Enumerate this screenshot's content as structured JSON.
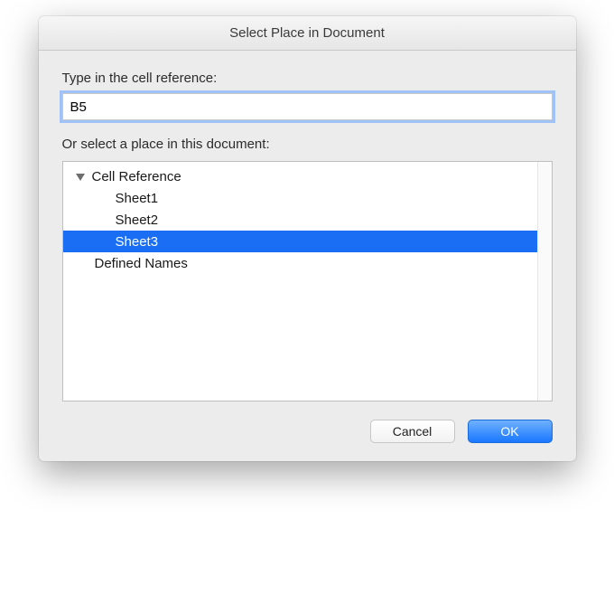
{
  "titlebar": {
    "title": "Select Place in Document"
  },
  "labels": {
    "cell_ref": "Type in the cell reference:",
    "or_select": "Or select a place in this document:"
  },
  "input": {
    "value": "B5"
  },
  "tree": {
    "group1_label": "Cell Reference",
    "group1_expanded": true,
    "group1_items": [
      "Sheet1",
      "Sheet2",
      "Sheet3"
    ],
    "group1_selected_index": 2,
    "group2_label": "Defined Names",
    "group2_expanded": false
  },
  "buttons": {
    "cancel": "Cancel",
    "ok": "OK"
  }
}
